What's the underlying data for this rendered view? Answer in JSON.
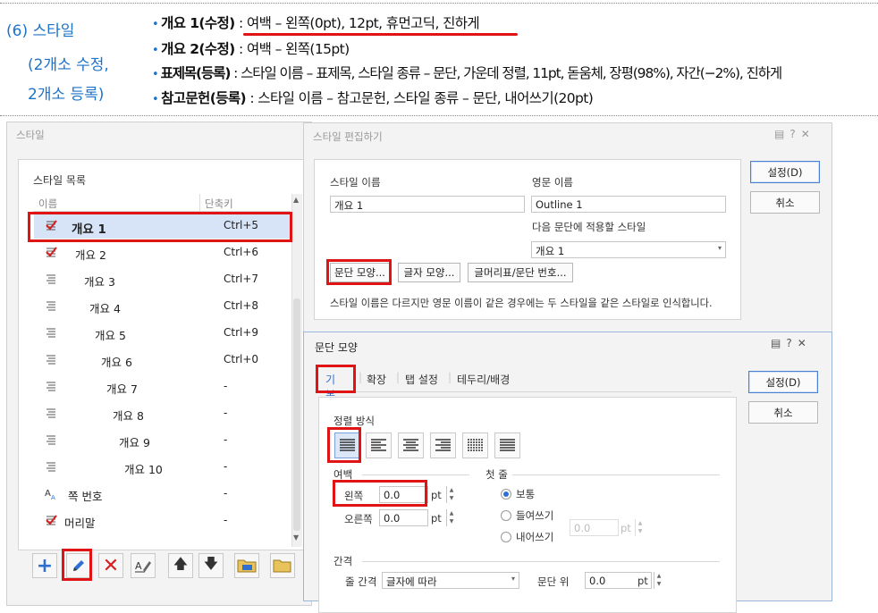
{
  "instructions": {
    "section_title": "(6) 스타일",
    "section_sub1": "(2개소 수정,",
    "section_sub2": "2개소 등록)",
    "lines": [
      {
        "bold": "개요 1(수정)",
        "rest": " : 여백 – 왼쪽(0pt), 12pt, 휴먼고딕, 진하게"
      },
      {
        "bold": "개요 2(수정)",
        "rest": " : 여백 – 왼쪽(15pt)"
      },
      {
        "bold": "표제목(등록)",
        "rest": " : 스타일 이름 – 표제목, 스타일 종류 – 문단, 가운데 정렬, 11pt, 돋움체, 장평(98%), 자간(−2%), 진하게"
      },
      {
        "bold": "참고문헌(등록)",
        "rest": " : 스타일 이름 – 참고문헌, 스타일 종류 – 문단, 내어쓰기(20pt)"
      }
    ]
  },
  "style_dialog": {
    "title": "스타일",
    "list_label": "스타일 목록",
    "col_name": "이름",
    "col_shortcut": "단축키",
    "items": [
      {
        "name": "개요 1",
        "shortcut": "Ctrl+5",
        "icon": "outline-check-icon"
      },
      {
        "name": "개요 2",
        "shortcut": "Ctrl+6",
        "icon": "outline-check-icon"
      },
      {
        "name": "개요 3",
        "shortcut": "Ctrl+7",
        "icon": "paragraph-lines-icon"
      },
      {
        "name": "개요 4",
        "shortcut": "Ctrl+8",
        "icon": "paragraph-lines-icon"
      },
      {
        "name": "개요 5",
        "shortcut": "Ctrl+9",
        "icon": "paragraph-lines-icon"
      },
      {
        "name": "개요 6",
        "shortcut": "Ctrl+0",
        "icon": "paragraph-lines-icon"
      },
      {
        "name": "개요 7",
        "shortcut": "-",
        "icon": "paragraph-lines-icon"
      },
      {
        "name": "개요 8",
        "shortcut": "-",
        "icon": "paragraph-lines-icon"
      },
      {
        "name": "개요 9",
        "shortcut": "-",
        "icon": "paragraph-lines-icon"
      },
      {
        "name": "개요 10",
        "shortcut": "-",
        "icon": "paragraph-lines-icon"
      },
      {
        "name": "쪽 번호",
        "shortcut": "-",
        "icon": "char-style-icon"
      },
      {
        "name": "머리말",
        "shortcut": "-",
        "icon": "outline-check-icon"
      }
    ]
  },
  "edit_dialog": {
    "title": "스타일 편집하기",
    "style_name_label": "스타일 이름",
    "style_name_value": "개요 1",
    "eng_name_label": "영문 이름",
    "eng_name_value": "Outline 1",
    "next_style_label": "다음 문단에 적용할 스타일",
    "next_style_value": "개요 1",
    "btn_para": "문단 모양...",
    "btn_char": "글자 모양...",
    "btn_bullet": "글머리표/문단 번호...",
    "note": "스타일 이름은 다르지만 영문 이름이 같은 경우에는 두 스타일을 같은 스타일로 인식합니다.",
    "ok": "설정(D)",
    "cancel": "취소"
  },
  "para_dialog": {
    "title": "문단 모양",
    "tabs": [
      "기본",
      "확장",
      "탭 설정",
      "테두리/배경"
    ],
    "align_label": "정렬 방식",
    "margin_label": "여백",
    "left_label": "왼쪽",
    "left_value": "0.0",
    "right_label": "오른쪽",
    "right_value": "0.0",
    "unit": "pt",
    "first_line_label": "첫 줄",
    "first_options": [
      "보통",
      "들여쓰기",
      "내어쓰기"
    ],
    "indent_value": "0.0",
    "spacing_label": "간격",
    "line_spacing_label": "줄 간격",
    "line_spacing_value": "글자에 따라",
    "para_above_label": "문단 위",
    "para_above_value": "0.0",
    "ok": "설정(D)",
    "cancel": "취소"
  }
}
